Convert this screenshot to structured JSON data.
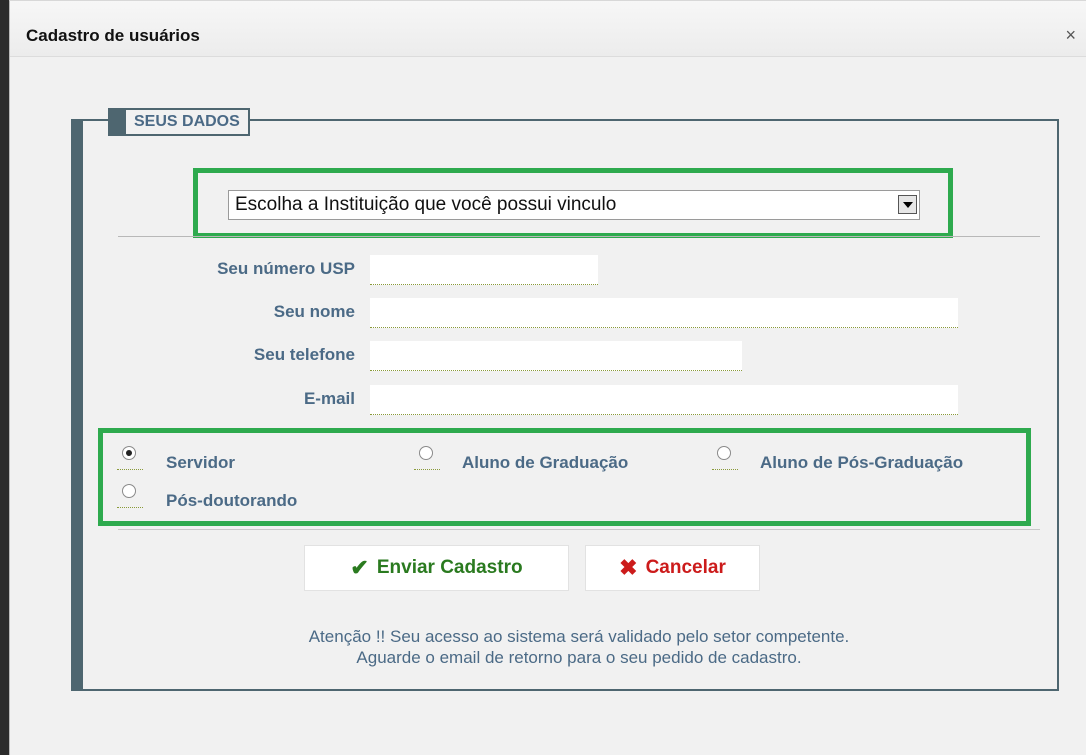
{
  "window": {
    "title": "Cadastro de usuários",
    "close_label": "×"
  },
  "fieldset": {
    "legend": "SEUS DADOS"
  },
  "institution_select": {
    "selected": "Escolha a Instituição que você possui vinculo"
  },
  "fields": {
    "usp_number_label": "Seu número USP",
    "name_label": "Seu nome",
    "phone_label": "Seu telefone",
    "email_label": "E-mail"
  },
  "roles": {
    "options": [
      "Servidor",
      "Aluno de Graduação",
      "Aluno de Pós-Graduação",
      "Pós-doutorando"
    ],
    "selected": "Servidor"
  },
  "buttons": {
    "submit_label": "Enviar Cadastro",
    "cancel_label": "Cancelar"
  },
  "notice": {
    "line1": "Atenção !! Seu acesso ao sistema será validado pelo setor competente.",
    "line2": "Aguarde o email de retorno para o seu pedido de cadastro."
  },
  "colors": {
    "highlight": "#2eaa4e",
    "label": "#4b6a86",
    "fieldset": "#4e6670",
    "submit": "#2a7a1f",
    "cancel": "#cc1b1b"
  }
}
